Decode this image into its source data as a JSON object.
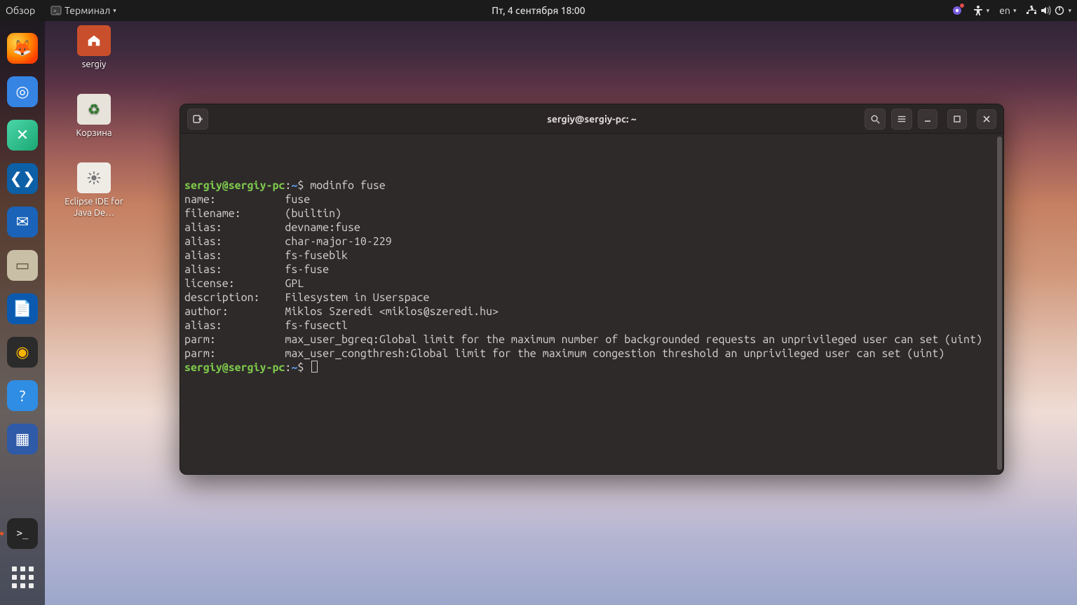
{
  "topbar": {
    "overview": "Обзор",
    "app_menu": "Терминал",
    "datetime": "Пт, 4 сентября  18:00",
    "lang": "en"
  },
  "dock": {
    "items": [
      {
        "name": "firefox",
        "glyph": "🦊"
      },
      {
        "name": "chromium",
        "glyph": "◎"
      },
      {
        "name": "remote-client",
        "glyph": "✕"
      },
      {
        "name": "vscode",
        "glyph": "❮❯"
      },
      {
        "name": "thunderbird",
        "glyph": "✉"
      },
      {
        "name": "files",
        "glyph": "▭"
      },
      {
        "name": "writer",
        "glyph": "📄"
      },
      {
        "name": "rhythmbox",
        "glyph": "◉"
      },
      {
        "name": "help",
        "glyph": "?"
      },
      {
        "name": "virtualbox",
        "glyph": "▦"
      }
    ],
    "terminal_glyph": ">_"
  },
  "desktop": {
    "icons": [
      {
        "id": "home",
        "label": "sergiy"
      },
      {
        "id": "trash",
        "label": "Корзина"
      },
      {
        "id": "eclipse",
        "label": "Eclipse IDE for Java De…"
      }
    ]
  },
  "window": {
    "title": "sergiy@sergiy-pc: ~",
    "prompt": {
      "user": "sergiy",
      "host": "sergiy-pc",
      "path": "~",
      "symbol": "$"
    },
    "command": "modinfo fuse",
    "output": [
      "name:           fuse",
      "filename:       (builtin)",
      "alias:          devname:fuse",
      "alias:          char-major-10-229",
      "alias:          fs-fuseblk",
      "alias:          fs-fuse",
      "license:        GPL",
      "description:    Filesystem in Userspace",
      "author:         Miklos Szeredi <miklos@szeredi.hu>",
      "alias:          fs-fusectl",
      "parm:           max_user_bgreq:Global limit for the maximum number of backgrounded requests an unprivileged user can set (uint)",
      "parm:           max_user_congthresh:Global limit for the maximum congestion threshold an unprivileged user can set (uint)"
    ]
  }
}
